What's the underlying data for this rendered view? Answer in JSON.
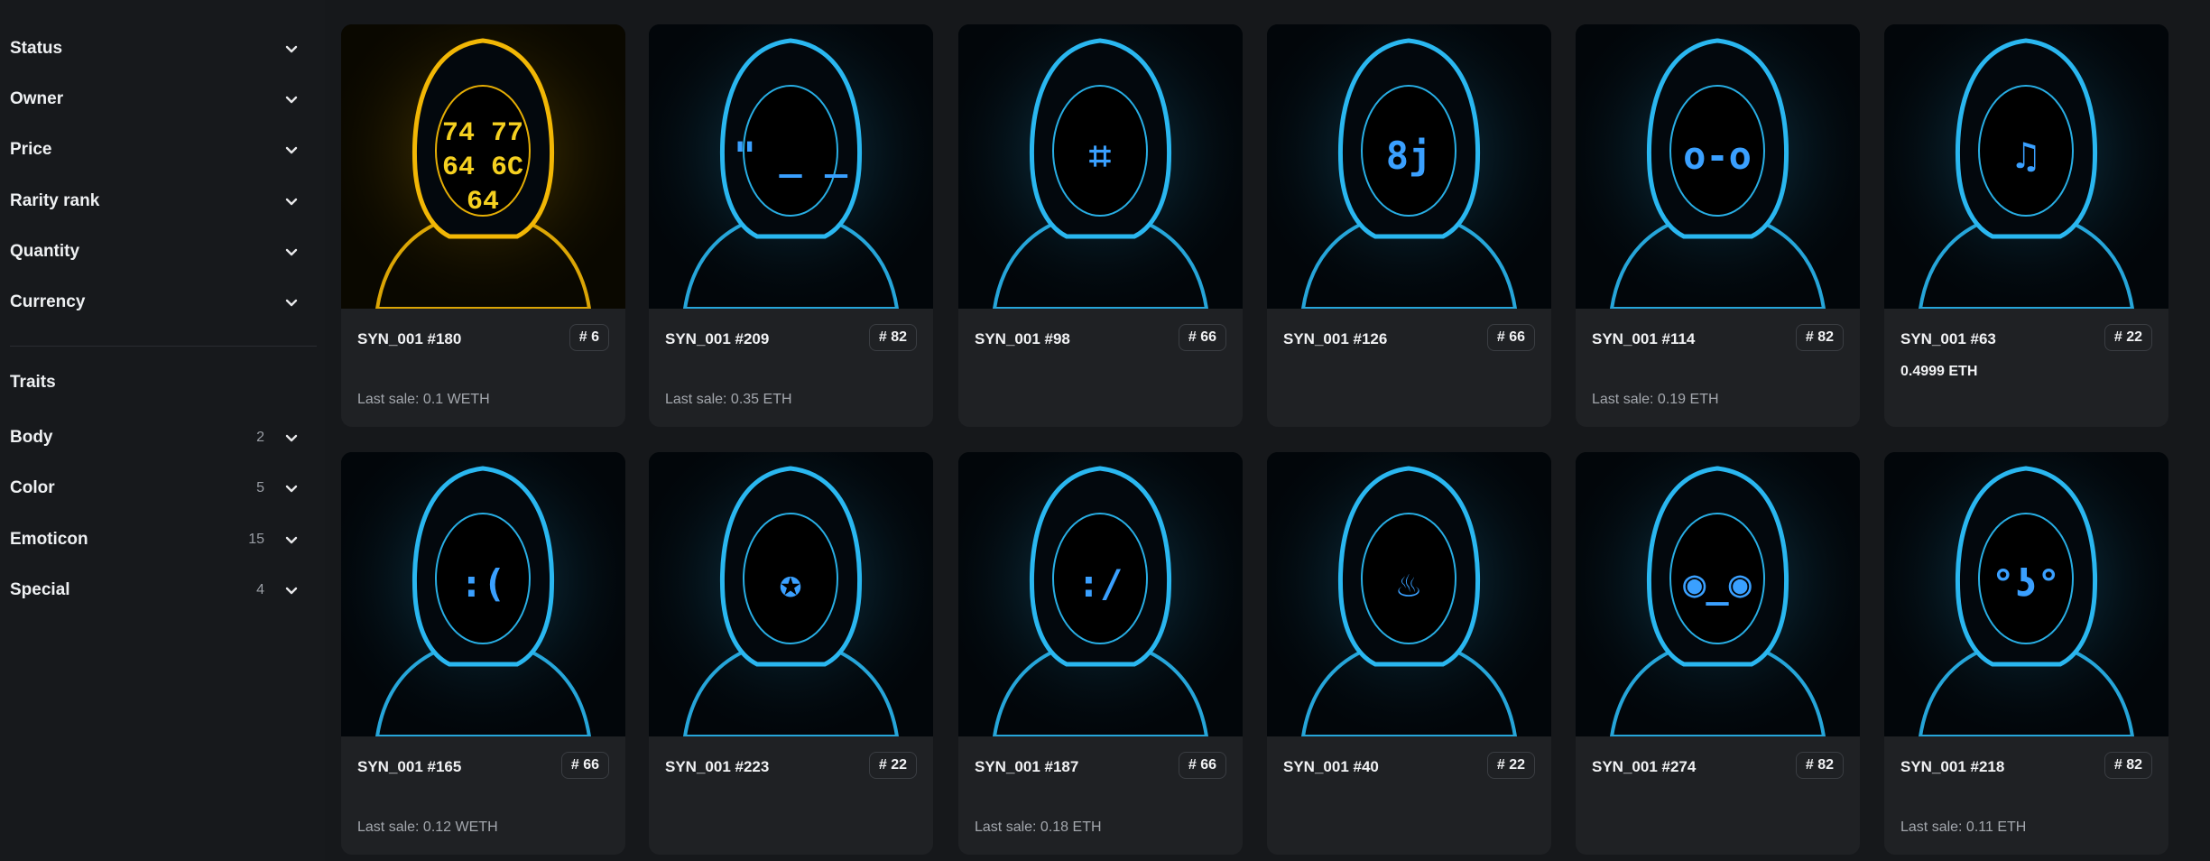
{
  "filters": [
    {
      "label": "Status",
      "count": ""
    },
    {
      "label": "Owner",
      "count": ""
    },
    {
      "label": "Price",
      "count": ""
    },
    {
      "label": "Rarity rank",
      "count": ""
    },
    {
      "label": "Quantity",
      "count": ""
    },
    {
      "label": "Currency",
      "count": ""
    }
  ],
  "traits_heading": "Traits",
  "traits": [
    {
      "label": "Body",
      "count": "2"
    },
    {
      "label": "Color",
      "count": "5"
    },
    {
      "label": "Emoticon",
      "count": "15"
    },
    {
      "label": "Special",
      "count": "4"
    }
  ],
  "cards": [
    {
      "name": "SYN_001 #180",
      "rank": "# 6",
      "price": "",
      "last_sale": "Last sale: 0.1 WETH",
      "hood_color": "#f2b705",
      "face": "74 77 64 6C 64"
    },
    {
      "name": "SYN_001 #209",
      "rank": "# 82",
      "price": "",
      "last_sale": "Last sale: 0.35 ETH",
      "hood_color": "#2ab7f0",
      "face": "\" _ _"
    },
    {
      "name": "SYN_001 #98",
      "rank": "# 66",
      "price": "",
      "last_sale": "",
      "hood_color": "#2ab7f0",
      "face": "⌗"
    },
    {
      "name": "SYN_001 #126",
      "rank": "# 66",
      "price": "",
      "last_sale": "",
      "hood_color": "#2ab7f0",
      "face": "8j"
    },
    {
      "name": "SYN_001 #114",
      "rank": "# 82",
      "price": "",
      "last_sale": "Last sale: 0.19 ETH",
      "hood_color": "#2ab7f0",
      "face": "o-o"
    },
    {
      "name": "SYN_001 #63",
      "rank": "# 22",
      "price": "0.4999 ETH",
      "last_sale": "",
      "hood_color": "#2ab7f0",
      "face": "♫"
    },
    {
      "name": "SYN_001 #165",
      "rank": "# 66",
      "price": "",
      "last_sale": "Last sale: 0.12 WETH",
      "hood_color": "#2ab7f0",
      "face": ":("
    },
    {
      "name": "SYN_001 #223",
      "rank": "# 22",
      "price": "",
      "last_sale": "",
      "hood_color": "#2ab7f0",
      "face": "✪"
    },
    {
      "name": "SYN_001 #187",
      "rank": "# 66",
      "price": "",
      "last_sale": "Last sale: 0.18 ETH",
      "hood_color": "#2ab7f0",
      "face": ":/"
    },
    {
      "name": "SYN_001 #40",
      "rank": "# 22",
      "price": "",
      "last_sale": "",
      "hood_color": "#2ab7f0",
      "face": "♨"
    },
    {
      "name": "SYN_001 #274",
      "rank": "# 82",
      "price": "",
      "last_sale": "",
      "hood_color": "#2ab7f0",
      "face": "◉_◉"
    },
    {
      "name": "SYN_001 #218",
      "rank": "# 82",
      "price": "",
      "last_sale": "Last sale: 0.11 ETH",
      "hood_color": "#2ab7f0",
      "face": "°ʖ°"
    }
  ]
}
